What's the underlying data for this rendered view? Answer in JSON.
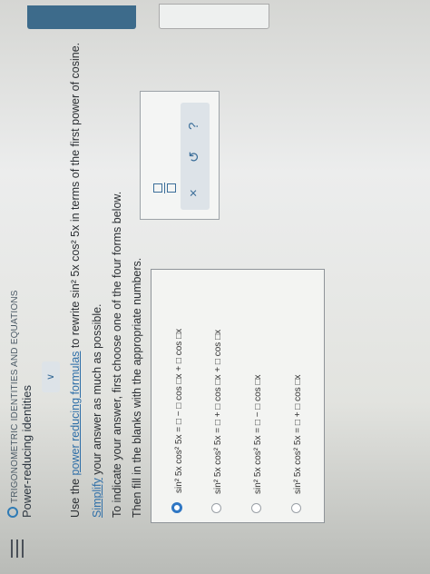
{
  "header": {
    "category": "TRIGONOMETRIC IDENTITIES AND EQUATIONS",
    "lesson": "Power-reducing identities",
    "collapse": "∨"
  },
  "question": {
    "line1_pre": "Use the ",
    "line1_link": "power reducing formulas",
    "line1_post": " to rewrite sin² 5x cos² 5x in terms of the first power of cosine.",
    "line2_link": "Simplify",
    "line2_post": " your answer as much as possible.",
    "line3": "To indicate your answer, first choose one of the four forms below.",
    "line4": "Then fill in the blanks with the appropriate numbers."
  },
  "options": [
    {
      "lhs": "sin² 5x cos² 5x =",
      "form": "□ − □ cos □x + □ cos □x",
      "selected": true
    },
    {
      "lhs": "sin² 5x cos² 5x =",
      "form": "□ + □ cos □x + □ cos □x",
      "selected": false
    },
    {
      "lhs": "sin² 5x cos² 5x =",
      "form": "□ − □ cos □x",
      "selected": false
    },
    {
      "lhs": "sin² 5x cos² 5x =",
      "form": "□ + □ cos □x",
      "selected": false
    }
  ],
  "tools": {
    "clear": "×",
    "undo": "↺",
    "help": "?"
  },
  "icons": [
    "menu-icon",
    "fraction-icon",
    "clear-icon",
    "undo-icon",
    "help-icon"
  ]
}
